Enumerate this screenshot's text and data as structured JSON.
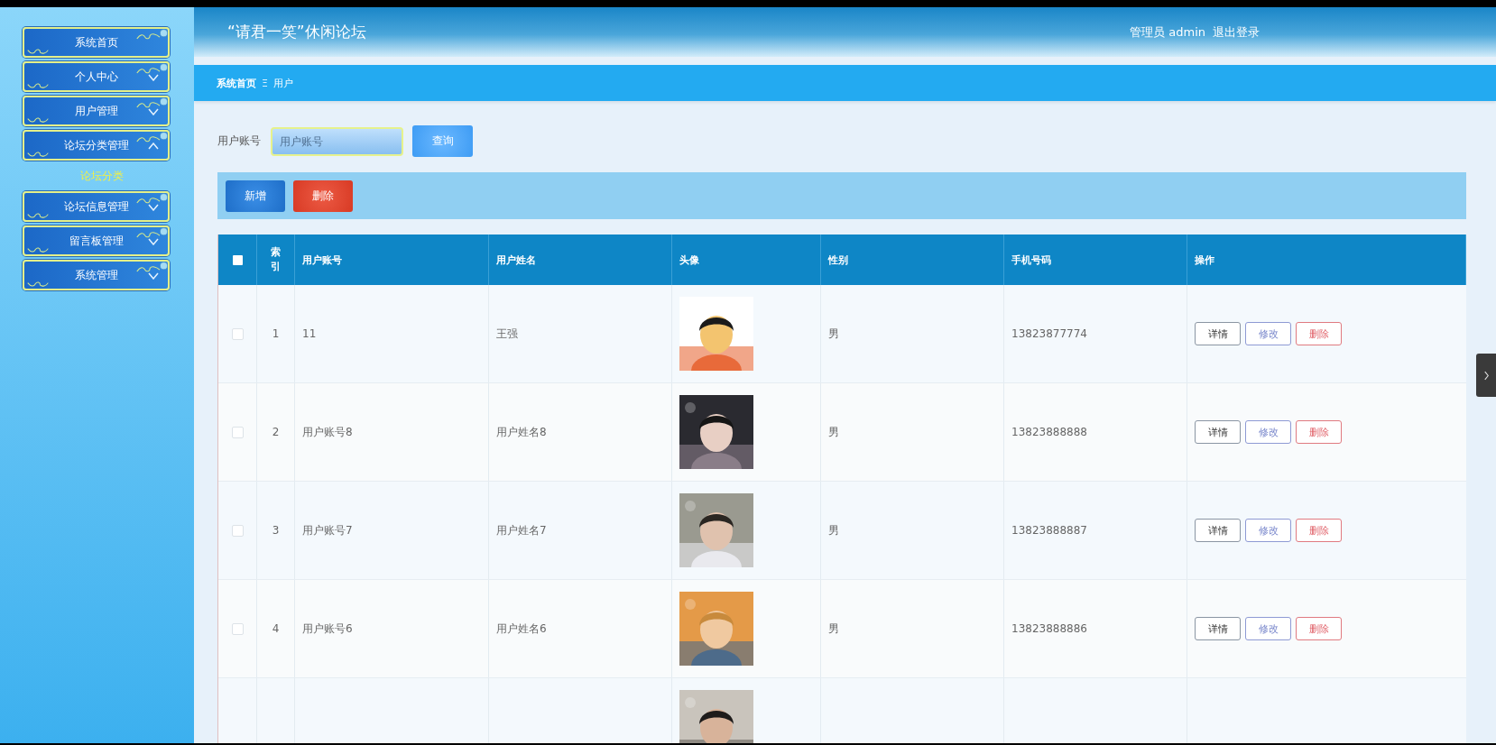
{
  "sidebar": {
    "items": [
      {
        "label": "系统首页",
        "kind": "link"
      },
      {
        "label": "个人中心",
        "kind": "menu",
        "expanded": false
      },
      {
        "label": "用户管理",
        "kind": "menu",
        "expanded": false
      },
      {
        "label": "论坛分类管理",
        "kind": "menu",
        "expanded": true,
        "children": [
          {
            "label": "论坛分类",
            "hovered": true
          }
        ]
      },
      {
        "label": "论坛信息管理",
        "kind": "menu",
        "expanded": false
      },
      {
        "label": "留言板管理",
        "kind": "menu",
        "expanded": false
      },
      {
        "label": "系统管理",
        "kind": "menu",
        "expanded": false
      }
    ]
  },
  "header": {
    "title": "“请君一笑”休闲论坛",
    "user_role": "管理员 admin",
    "logout": "退出登录"
  },
  "breadcrumb": [
    "系统首页",
    "用户"
  ],
  "breadcrumb_separator": "Ξ",
  "search": {
    "label": "用户账号",
    "placeholder": "用户账号",
    "button": "查询"
  },
  "toolbar": [
    {
      "label": "新增",
      "kind": "primary"
    },
    {
      "label": "删除",
      "kind": "danger"
    }
  ],
  "table": {
    "select_all": {
      "checked": false
    },
    "columns": [
      "索引",
      "用户账号",
      "用户姓名",
      "头像",
      "性别",
      "手机号码",
      "操作"
    ],
    "rows": [
      {
        "checked": false,
        "index": "1",
        "account": "11",
        "name": "王强",
        "avatar": {
          "kind": "picture"
        },
        "gender": "男",
        "phone": "13823877774",
        "actions": [
          "详情",
          "修改",
          "删除"
        ]
      },
      {
        "checked": false,
        "index": "2",
        "account": "用户账号8",
        "name": "用户姓名8",
        "avatar": {
          "kind": "picture"
        },
        "gender": "男",
        "phone": "13823888888",
        "actions": [
          "详情",
          "修改",
          "删除"
        ]
      },
      {
        "checked": false,
        "index": "3",
        "account": "用户账号7",
        "name": "用户姓名7",
        "avatar": {
          "kind": "picture"
        },
        "gender": "男",
        "phone": "13823888887",
        "actions": [
          "详情",
          "修改",
          "删除"
        ]
      },
      {
        "checked": false,
        "index": "4",
        "account": "用户账号6",
        "name": "用户姓名6",
        "avatar": {
          "kind": "picture"
        },
        "gender": "男",
        "phone": "13823888886",
        "actions": [
          "详情",
          "修改",
          "删除"
        ]
      },
      {
        "avatar": {
          "kind": "picture"
        }
      }
    ]
  }
}
